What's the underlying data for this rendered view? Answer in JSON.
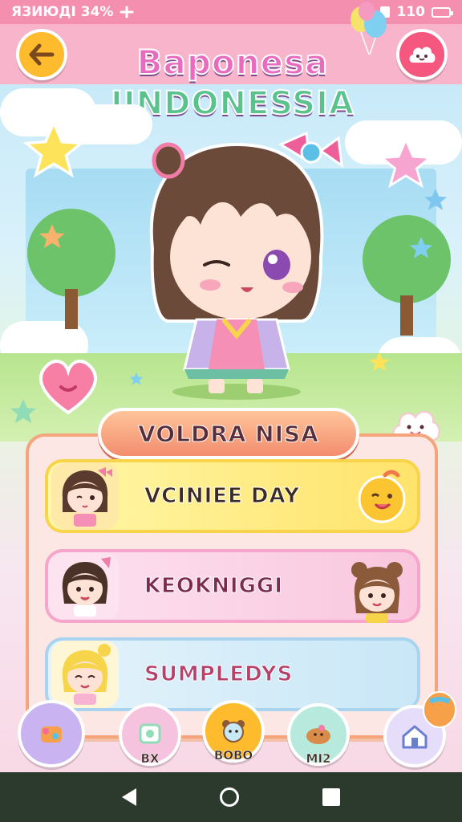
{
  "status_bar": {
    "left_text": "ЯЗИЮДІ 34%",
    "right_text": "110"
  },
  "header": {
    "title_line1": "Baponesa",
    "title_line2": "IINDONESSIA"
  },
  "panel": {
    "title": "VOLDRA NISA",
    "rows": [
      {
        "label": "VCINIEE DAY"
      },
      {
        "label": "KEOKNIGGI"
      },
      {
        "label": "SUMPLEDYS"
      }
    ]
  },
  "bottom_nav": {
    "items": [
      {
        "label": ""
      },
      {
        "label": "BX"
      },
      {
        "label": "BOBO"
      },
      {
        "label": "MI2"
      },
      {
        "label": ""
      }
    ]
  },
  "colors": {
    "status_bar": "#f58fb0",
    "back_button": "#fdbb2d",
    "mascot_button": "#f5577f",
    "panel_border": "#f5a47b",
    "panel_title": "#f38d6e"
  },
  "icons": {
    "back": "arrow-left-icon",
    "mascot": "cloud-face-icon",
    "home": "home-icon"
  }
}
